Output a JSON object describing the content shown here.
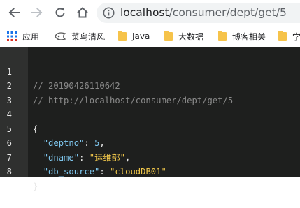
{
  "toolbar": {
    "url_host": "localhost",
    "url_path": "/consumer/dept/get/5"
  },
  "bookmarks": [
    {
      "label": "应用",
      "icon": "apps-grid-icon"
    },
    {
      "label": "菜鸟清风",
      "icon": "site-favicon-icon"
    },
    {
      "label": "Java",
      "icon": "folder-icon"
    },
    {
      "label": "大数据",
      "icon": "folder-icon"
    },
    {
      "label": "博客相关",
      "icon": "folder-icon"
    },
    {
      "label": "学",
      "icon": "folder-icon"
    }
  ],
  "code": {
    "line_numbers": [
      "1",
      "2",
      "3",
      "4",
      "5",
      "6",
      "7",
      "8"
    ],
    "comment_timestamp": "// 20190426110642",
    "comment_url": "// http://localhost/consumer/dept/get/5",
    "open_brace": "{",
    "close_brace": "}",
    "fields": [
      {
        "key": "\"deptno\"",
        "value": "5",
        "sep": ","
      },
      {
        "key": "\"dname\"",
        "value": "\"运维部\"",
        "sep": ","
      },
      {
        "key": "\"db_source\"",
        "value": "\"cloudDB01\"",
        "sep": ""
      }
    ]
  },
  "colors": {
    "editor_bg": "#1e1f1e",
    "gutter_bg": "#2f302f",
    "key": "#7fc8f0",
    "string": "#f2c84b",
    "comment": "#8a8a8a"
  }
}
